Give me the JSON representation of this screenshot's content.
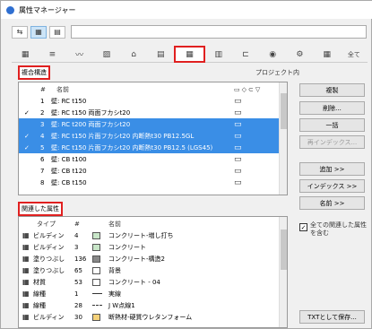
{
  "window": {
    "title": "属性マネージャー"
  },
  "toolbar": {
    "icons": [
      "import-icon",
      "grid-view-icon",
      "list-view-icon"
    ],
    "search_value": ""
  },
  "tabs": [
    {
      "label": "▦",
      "icon": "layers-icon"
    },
    {
      "label": "≡",
      "icon": "pen-icon"
    },
    {
      "label": "〰",
      "icon": "line-type-icon"
    },
    {
      "label": "▨",
      "icon": "hatch-icon"
    },
    {
      "label": "⌂",
      "icon": "material-icon"
    },
    {
      "label": "▤",
      "icon": "profile-icon"
    },
    {
      "label": "▦",
      "icon": "composite-icon"
    },
    {
      "label": "▥",
      "icon": "zone-icon"
    },
    {
      "label": "⊏",
      "icon": "mep-icon"
    },
    {
      "label": "◉",
      "icon": "markup-icon"
    },
    {
      "label": "⚙",
      "icon": "operation-icon"
    },
    {
      "label": "▦",
      "icon": "table-icon"
    },
    {
      "label": "全て",
      "icon": ""
    }
  ],
  "composite": {
    "section_label": "複合構造",
    "project_label": "プロジェクト内",
    "col_hash": "#",
    "col_name": "名前",
    "rows": [
      {
        "check": "",
        "num": "1",
        "name": "壁: RC t150",
        "sel": false
      },
      {
        "check": "✓",
        "num": "2",
        "name": "壁: RC t150 両面フカシt20",
        "sel": false
      },
      {
        "check": "",
        "num": "3",
        "name": "壁: RC t200 両面フカシt20",
        "sel": true
      },
      {
        "check": "✓",
        "num": "4",
        "name": "壁: RC t150 片面フカシt20 内断熱t30 PB12.5GL",
        "sel": true
      },
      {
        "check": "✓",
        "num": "5",
        "name": "壁: RC t150 片面フカシt20 内断熱t30 PB12.5 (LGS45)",
        "sel": true
      },
      {
        "check": "",
        "num": "6",
        "name": "壁: CB t100",
        "sel": false
      },
      {
        "check": "",
        "num": "7",
        "name": "壁: CB t120",
        "sel": false
      },
      {
        "check": "",
        "num": "8",
        "name": "壁: CB t150",
        "sel": false
      }
    ]
  },
  "buttons": {
    "copy": "複製",
    "delete": "削除...",
    "replace": "一括",
    "reindex": "再インデックス...",
    "add": "追加 >>",
    "index": "インデックス >>",
    "name": "名前 >>",
    "save_txt": "TXTとして保存..."
  },
  "related": {
    "section_label": "関連した属性",
    "col_type": "タイプ",
    "col_hash": "#",
    "col_name": "名前",
    "rows": [
      {
        "type": "ビルディン",
        "num": "4",
        "name": "コンクリート-増し打ち",
        "swatch": "#c8e6c8"
      },
      {
        "type": "ビルディン",
        "num": "3",
        "name": "コンクリート",
        "swatch": "#c8e6c8"
      },
      {
        "type": "塗りつぶし",
        "num": "136",
        "name": "コンクリート-構造2",
        "swatch": "#888888"
      },
      {
        "type": "塗りつぶし",
        "num": "65",
        "name": "背景",
        "swatch": "#ffffff"
      },
      {
        "type": "材質",
        "num": "53",
        "name": "コンクリート - 04",
        "swatch": "#ffffff"
      },
      {
        "type": "線種",
        "num": "1",
        "name": "実線",
        "swatch": ""
      },
      {
        "type": "線種",
        "num": "28",
        "name": "J W点線1",
        "swatch": ""
      },
      {
        "type": "ビルディン",
        "num": "30",
        "name": "断熱材-硬質ウレタンフォーム",
        "swatch": "#f5d27a"
      }
    ],
    "checkbox_label": "全ての関連した属性を含む"
  }
}
